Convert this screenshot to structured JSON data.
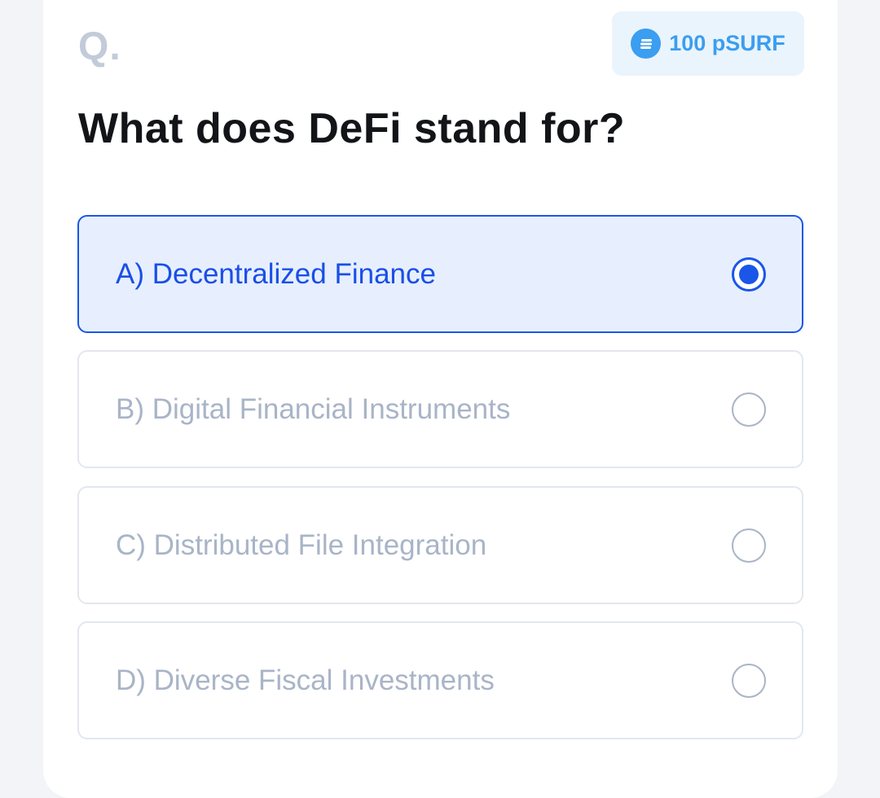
{
  "question": {
    "label": "Q.",
    "text": "What does DeFi stand for?"
  },
  "reward": {
    "icon": "token-icon",
    "text": "100 pSURF"
  },
  "options": [
    {
      "label": "A) Decentralized Finance",
      "selected": true
    },
    {
      "label": "B) Digital Financial Instruments",
      "selected": false
    },
    {
      "label": "C) Distributed File Integration",
      "selected": false
    },
    {
      "label": "D) Diverse Fiscal Investments",
      "selected": false
    }
  ],
  "colors": {
    "accent": "#1a56e8",
    "reward_accent": "#3b9ef0",
    "muted_text": "#a9b4c7"
  }
}
